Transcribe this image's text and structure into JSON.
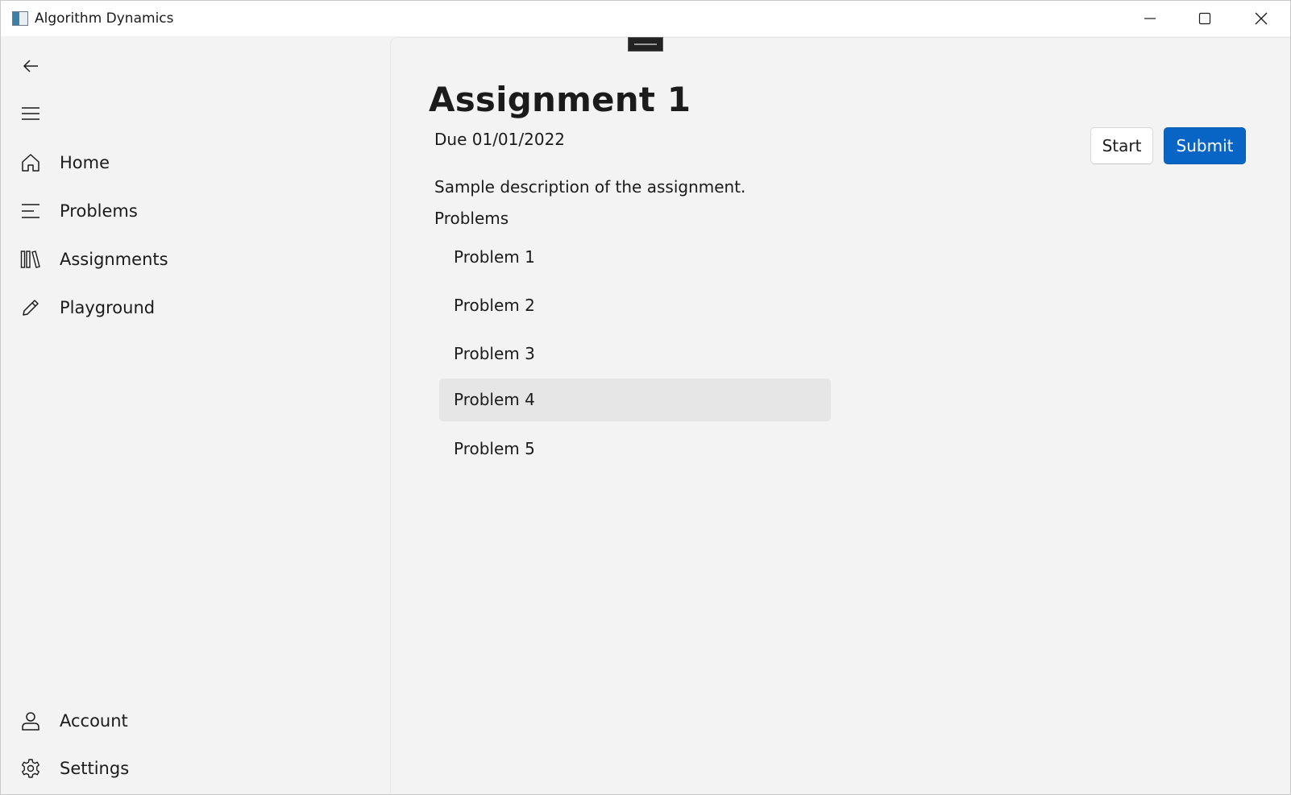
{
  "window": {
    "title": "Algorithm Dynamics"
  },
  "nav": {
    "items": [
      {
        "label": "Home",
        "icon": "home-icon"
      },
      {
        "label": "Problems",
        "icon": "list-icon"
      },
      {
        "label": "Assignments",
        "icon": "library-icon"
      },
      {
        "label": "Playground",
        "icon": "pencil-icon"
      }
    ],
    "footer": [
      {
        "label": "Account",
        "icon": "person-icon"
      },
      {
        "label": "Settings",
        "icon": "gear-icon"
      }
    ]
  },
  "assignment": {
    "title": "Assignment 1",
    "due": "Due 01/01/2022",
    "description": "Sample description of the assignment.",
    "problems_label": "Problems",
    "problems": [
      "Problem 1",
      "Problem 2",
      "Problem 3",
      "Problem 4",
      "Problem 5"
    ],
    "hovered_problem": "Problem 4",
    "start_label": "Start",
    "submit_label": "Submit"
  },
  "colors": {
    "accent": "#0864c5",
    "background": "#f3f3f3",
    "titlebar": "#ffffff",
    "hover": "#e6e6e6"
  }
}
